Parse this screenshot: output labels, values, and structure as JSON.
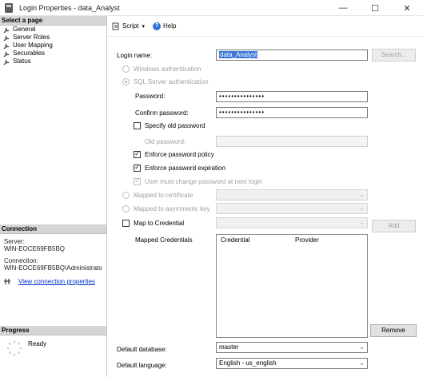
{
  "window": {
    "title": "Login Properties - data_Analyst",
    "minimize": "—",
    "maximize": "☐",
    "close": "✕"
  },
  "left": {
    "select_page_header": "Select a page",
    "pages": [
      "General",
      "Server Roles",
      "User Mapping",
      "Securables",
      "Status"
    ],
    "connection_header": "Connection",
    "server_label": "Server:",
    "server_value": "WIN-EOCE69FB5BQ",
    "connection_label": "Connection:",
    "connection_value": "WIN-EOCE69FB5BQ\\Administrato",
    "view_link": "View connection properties",
    "progress_header": "Progress",
    "progress_status": "Ready"
  },
  "toolbar": {
    "script": "Script",
    "help": "Help"
  },
  "form": {
    "login_name_label": "Login name:",
    "login_name_value": "data_Analyst",
    "search_button": "Search...",
    "windows_auth": "Windows authentication",
    "sql_auth": "SQL Server authentication",
    "password_label": "Password:",
    "password_value": "•••••••••••••••",
    "confirm_label": "Confirm password:",
    "confirm_value": "•••••••••••••••",
    "specify_old": "Specify old password",
    "old_password_label": "Old password:",
    "enforce_policy": "Enforce password policy",
    "enforce_expiration": "Enforce password expiration",
    "must_change": "User must change password at next login",
    "mapped_cert": "Mapped to certificate",
    "mapped_asym": "Mapped to asymmetric key",
    "map_credential": "Map to Credential",
    "add_button": "Add",
    "mapped_credentials_label": "Mapped Credentials",
    "col_credential": "Credential",
    "col_provider": "Provider",
    "remove_button": "Remove",
    "default_db_label": "Default database:",
    "default_db_value": "master",
    "default_lang_label": "Default language:",
    "default_lang_value": "English - us_english"
  },
  "icons": {
    "dropdown": "⌄",
    "chevron": "▾"
  }
}
